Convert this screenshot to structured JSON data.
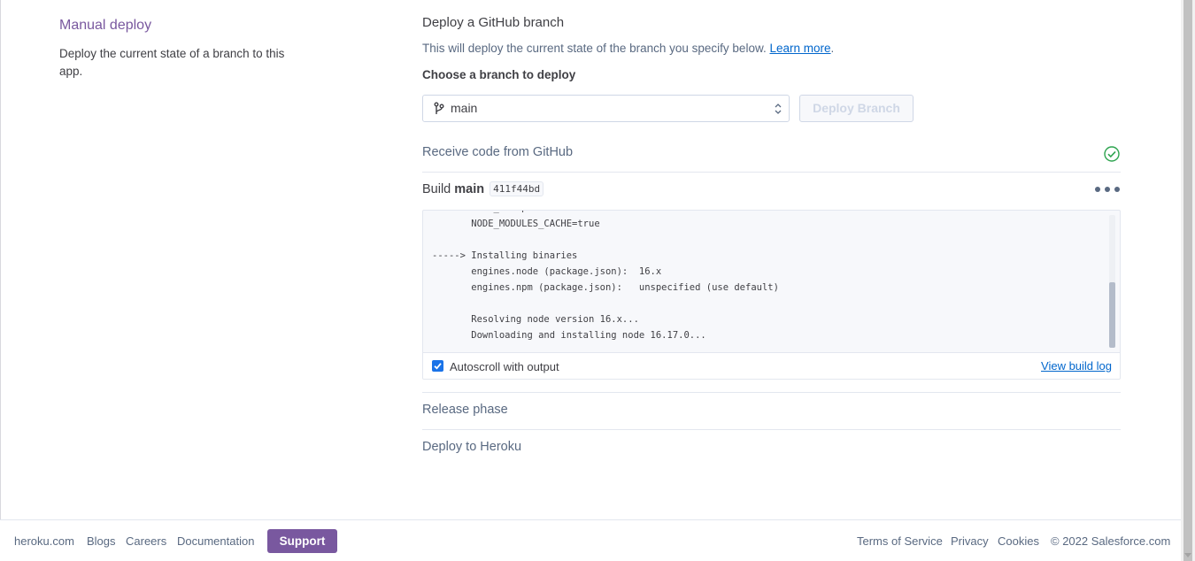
{
  "manual_deploy": {
    "title": "Manual deploy",
    "description": "Deploy the current state of a branch to this app."
  },
  "github": {
    "title": "Deploy a GitHub branch",
    "description": "This will deploy the current state of the branch you specify below.",
    "learn_more": "Learn more",
    "period": ".",
    "choose_label": "Choose a branch to deploy",
    "branch_value": "main",
    "deploy_button": "Deploy Branch"
  },
  "steps": {
    "receive": "Receive code from GitHub",
    "build_prefix": "Build",
    "build_branch": "main",
    "build_commit": "411f44bd",
    "release": "Release phase",
    "deploy": "Deploy to Heroku"
  },
  "log": {
    "lines": "       NODE_ENV=production\n       NODE_MODULES_CACHE=true\n\n-----> Installing binaries\n       engines.node (package.json):  16.x\n       engines.npm (package.json):   unspecified (use default)\n\n       Resolving node version 16.x...\n       Downloading and installing node 16.17.0...",
    "autoscroll_label": "Autoscroll with output",
    "autoscroll_checked": true,
    "view_build_log": "View build log"
  },
  "footer": {
    "heroku": "heroku.com",
    "blogs": "Blogs",
    "careers": "Careers",
    "documentation": "Documentation",
    "support": "Support",
    "terms": "Terms of Service",
    "privacy": "Privacy",
    "cookies": "Cookies",
    "copyright": "© 2022 Salesforce.com"
  },
  "colors": {
    "brand_purple": "#79589f",
    "link_blue": "#0066cc",
    "success_green": "#2ea44f"
  },
  "icons": [
    "branch-icon",
    "select-arrows-icon",
    "check-circle-icon",
    "more-dots-icon",
    "checkbox-checked-icon"
  ]
}
